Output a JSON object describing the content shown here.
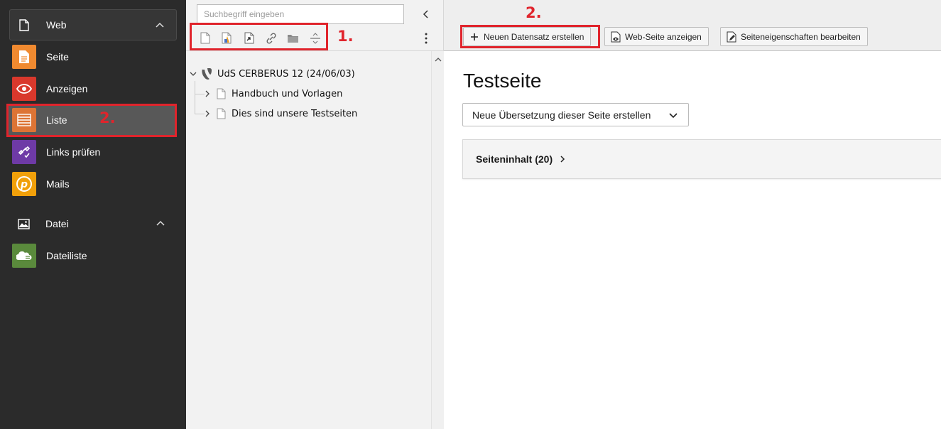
{
  "sidebar": {
    "groups": [
      {
        "label": "Web",
        "icon": "page-icon"
      },
      {
        "label": "Datei",
        "icon": "image-icon"
      }
    ],
    "items": [
      {
        "label": "Seite",
        "icon": "page-module-icon",
        "color": "#f08a30"
      },
      {
        "label": "Anzeigen",
        "icon": "eye-icon",
        "color": "#d9382c"
      },
      {
        "label": "Liste",
        "icon": "list-icon",
        "color": "#dd7435"
      },
      {
        "label": "Links prüfen",
        "icon": "link-check-icon",
        "color": "#6e3aa6"
      },
      {
        "label": "Mails",
        "icon": "mail-p-icon",
        "color": "#f1a00a"
      },
      {
        "label": "Dateiliste",
        "icon": "folder-cloud-icon",
        "color": "#5a8a3c"
      }
    ]
  },
  "tree": {
    "search_placeholder": "Suchbegriff eingeben",
    "toolbar_icons": [
      "new-page-icon",
      "new-page-advanced-icon",
      "new-shortcut-icon",
      "link-icon",
      "folder-icon",
      "divider-icon"
    ],
    "root_label": "UdS CERBERUS 12 (24/06/03)",
    "nodes": [
      {
        "label": "Handbuch und Vorlagen"
      },
      {
        "label": "Dies sind unsere Testseiten"
      }
    ]
  },
  "content": {
    "buttons": {
      "new_record": "Neuen Datensatz erstellen",
      "view_page": "Web-Seite anzeigen",
      "edit_props": "Seiteneigenschaften bearbeiten"
    },
    "page_title": "Testseite",
    "language_select": "Neue Übersetzung dieser Seite erstellen",
    "panel_title": "Seiteninhalt (20)"
  },
  "annotations": {
    "step1": "1.",
    "step2": "2."
  },
  "colors": {
    "highlight": "#e0242c",
    "sidebar_bg": "#2b2b2b",
    "tree_bg": "#f2f2f2"
  }
}
